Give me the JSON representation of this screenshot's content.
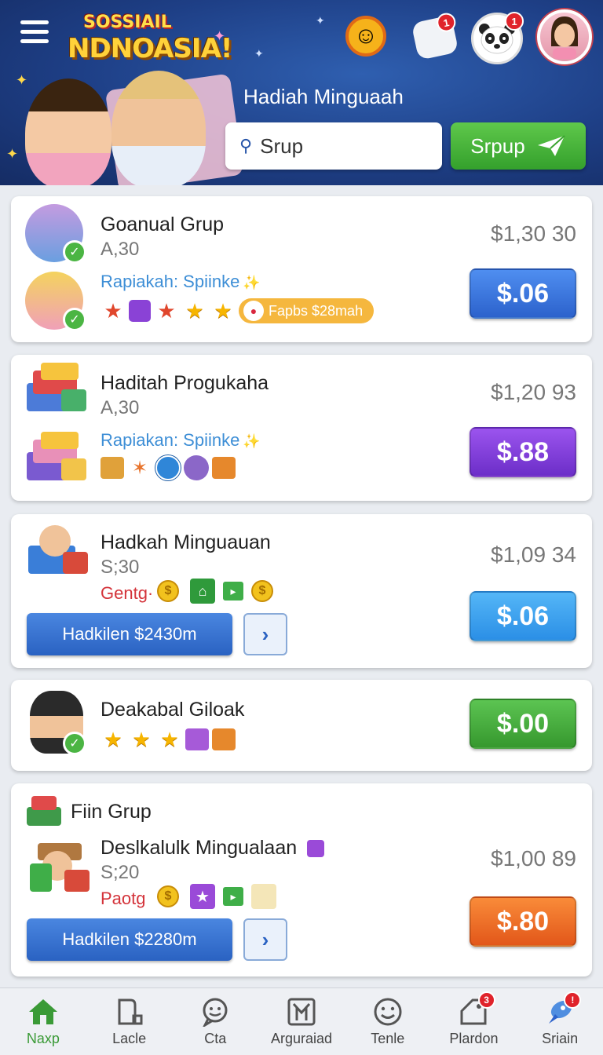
{
  "header": {
    "logo_line1": "SOSSIAIL",
    "logo_line2": "NDNOASIA!",
    "title": "Hadiah Minguaah",
    "search_placeholder": "Srup",
    "send_label": "Srpup",
    "notifications": {
      "pillow_badge": "1",
      "panda_badge": "1"
    },
    "icons": [
      "menu-icon",
      "smiley-icon",
      "pillow-icon",
      "panda-icon",
      "profile-avatar",
      "search-icon",
      "paper-plane-icon"
    ]
  },
  "cards": [
    {
      "title": "Goanual Grup",
      "sub": "A,30",
      "sub2": "Rapiakah: Spiinke",
      "pill": "Fapbs $28mah",
      "price": "$1,30 30",
      "button": "$.06",
      "button_color": "#2c62cc"
    },
    {
      "title": "Haditah Progukaha",
      "sub": "A,30",
      "sub2": "Rapiakan: Spiinke",
      "price": "$1,20 93",
      "button": "$.88",
      "button_color": "#6c2ec8"
    },
    {
      "title": "Hadkah Minguauan",
      "sub": "S;30",
      "sub2": "Gentg·",
      "wide_button": "Hadkilen $2430m",
      "price": "$1,09 34",
      "button": "$.06",
      "button_color": "#2b8fe6"
    },
    {
      "title": "Deakabal Giloak",
      "button": "$.00",
      "button_color": "#36982e"
    },
    {
      "header": "Fiin Grup",
      "title": "Deslkalulk Mingualaan",
      "sub": "S;20",
      "sub2": "Paotg",
      "wide_button": "Hadkilen $2280m",
      "price": "$1,00 89",
      "button": "$.80",
      "button_color": "#e2571a"
    }
  ],
  "nav": [
    {
      "label": "Naxp",
      "icon": "home-icon",
      "active": true
    },
    {
      "label": "Lacle",
      "icon": "document-icon"
    },
    {
      "label": "Cta",
      "icon": "chat-icon"
    },
    {
      "label": "Arguraiad",
      "icon": "grid-icon"
    },
    {
      "label": "Tenle",
      "icon": "smile-icon"
    },
    {
      "label": "Plardon",
      "icon": "tag-icon",
      "badge": "3"
    },
    {
      "label": "Sriain",
      "icon": "rocket-icon",
      "badge": "!"
    }
  ]
}
